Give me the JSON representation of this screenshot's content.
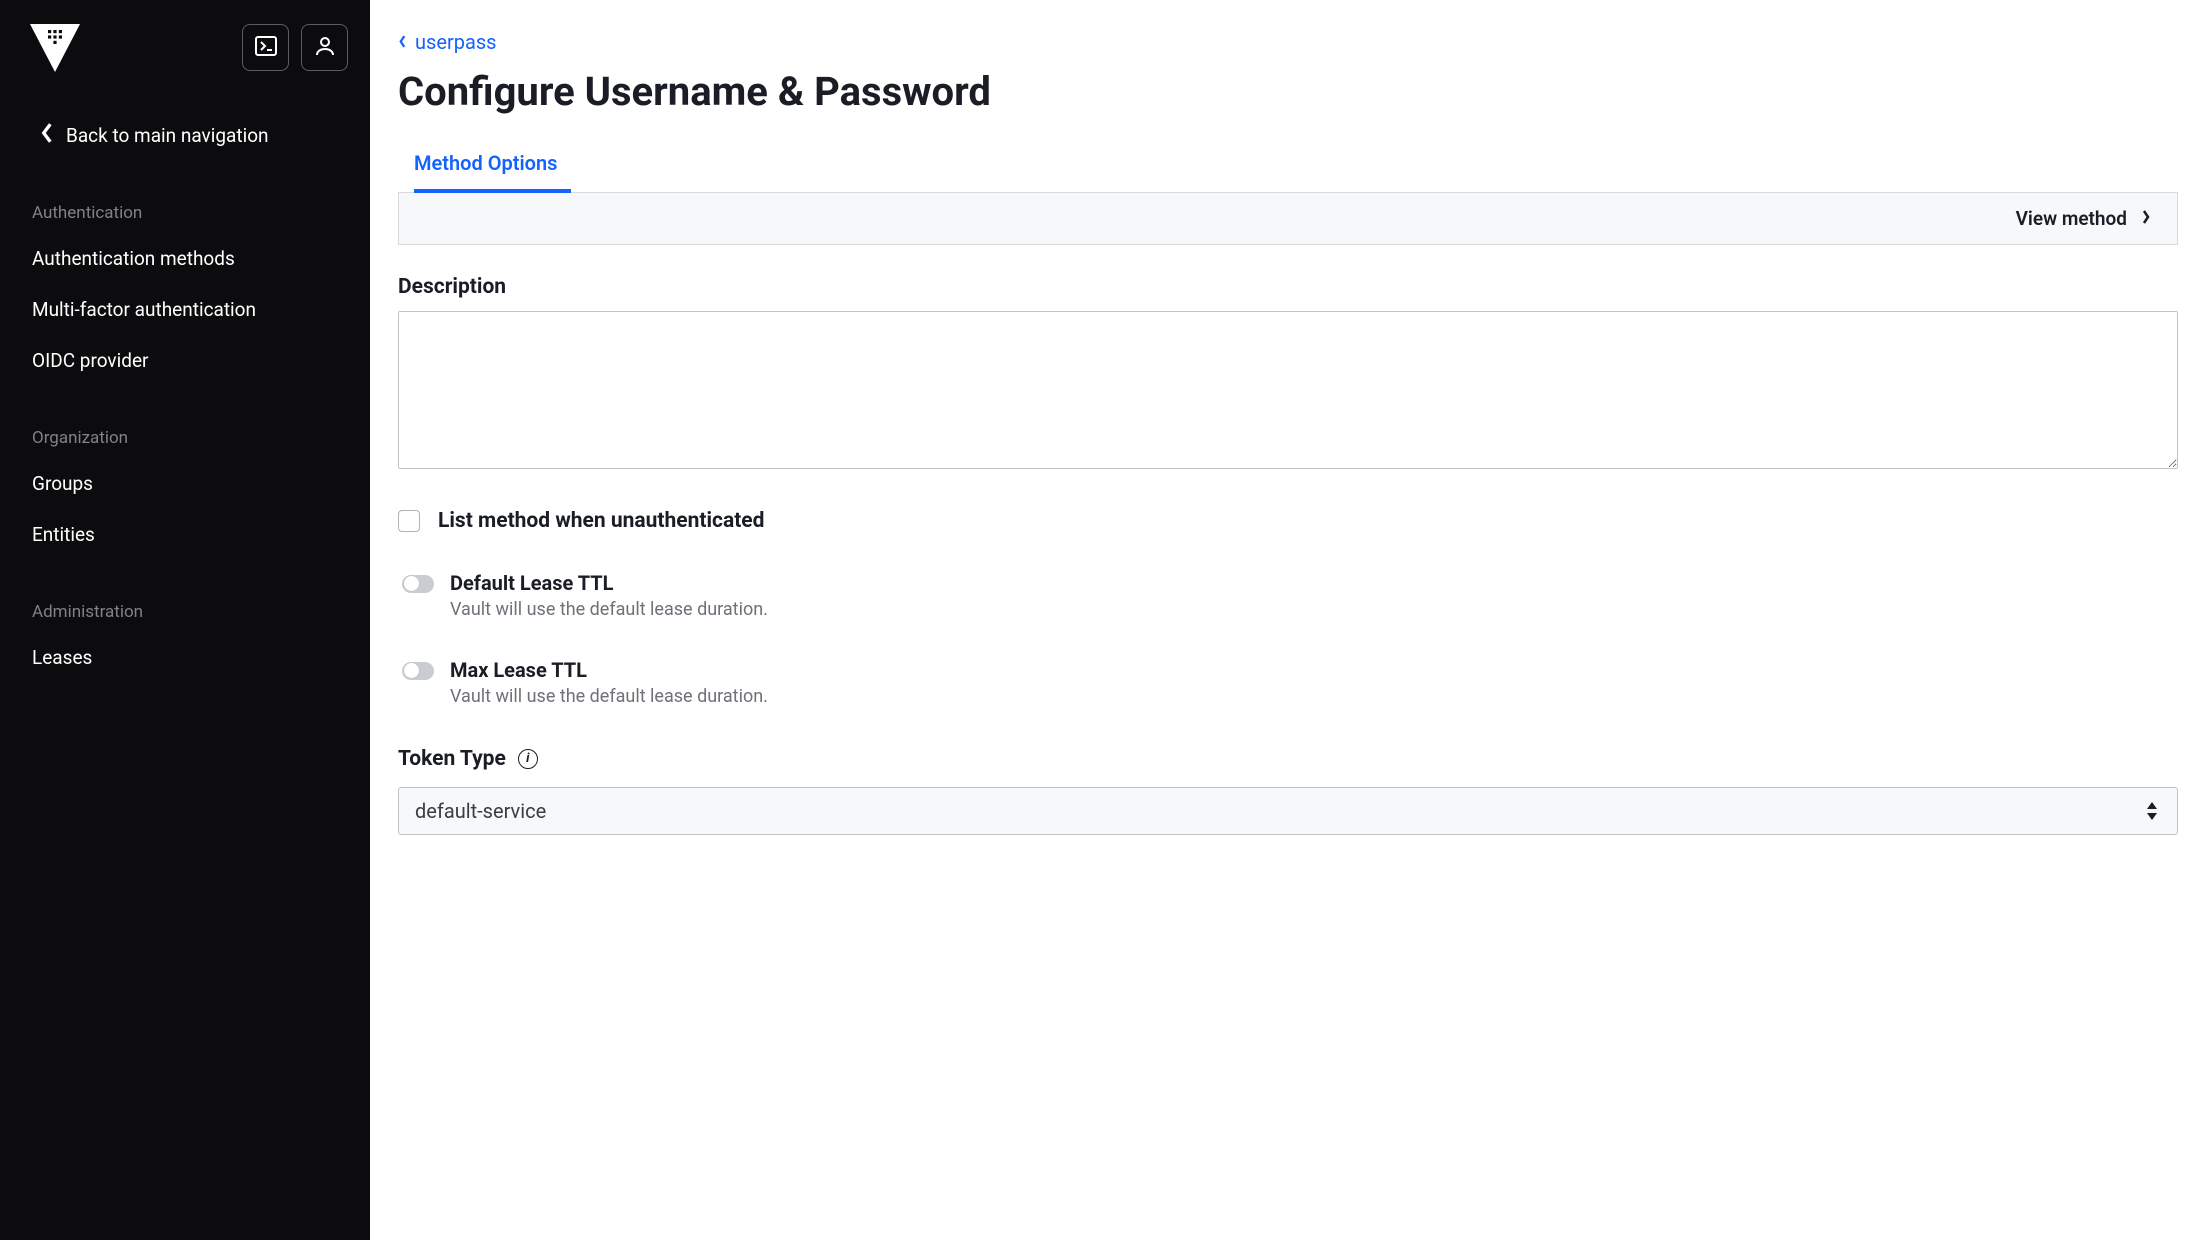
{
  "sidebar": {
    "back_label": "Back to main navigation",
    "sections": [
      {
        "header": "Authentication",
        "items": [
          "Authentication methods",
          "Multi-factor authentication",
          "OIDC provider"
        ]
      },
      {
        "header": "Organization",
        "items": [
          "Groups",
          "Entities"
        ]
      },
      {
        "header": "Administration",
        "items": [
          "Leases"
        ]
      }
    ]
  },
  "breadcrumb": {
    "label": "userpass"
  },
  "page": {
    "title": "Configure Username & Password",
    "tab": "Method Options",
    "view_method": "View method"
  },
  "form": {
    "description_label": "Description",
    "description_value": "",
    "list_unauth_label": "List method when unauthenticated",
    "default_ttl_title": "Default Lease TTL",
    "default_ttl_sub": "Vault will use the default lease duration.",
    "max_ttl_title": "Max Lease TTL",
    "max_ttl_sub": "Vault will use the default lease duration.",
    "token_type_label": "Token Type",
    "token_type_value": "default-service"
  }
}
